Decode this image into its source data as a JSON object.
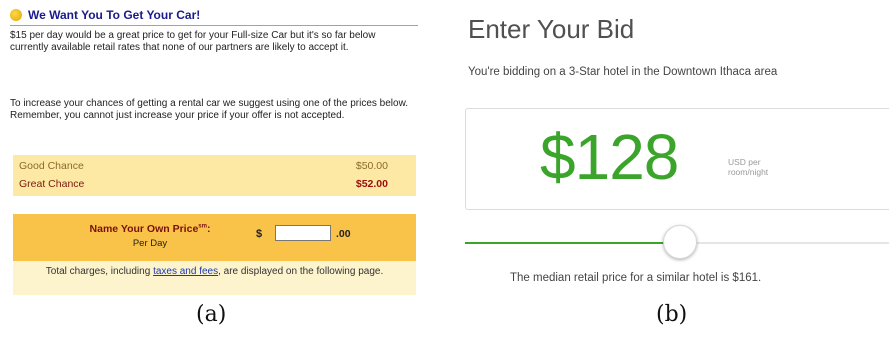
{
  "panel_a": {
    "title": "We Want You To Get Your Car!",
    "paragraph1": "$15 per day would be a great price to get for your Full-size Car but it's so far below currently available retail rates that none of our partners are likely to accept it.",
    "paragraph2": "To increase your chances of getting a rental car we suggest using one of the prices below. Remember, you cannot just increase your price if your offer is not accepted.",
    "options": [
      {
        "label": "Good Chance",
        "price": "$50.00"
      },
      {
        "label": "Great Chance",
        "price": "$52.00"
      }
    ],
    "name_price_label": "Name Your Own Price",
    "name_price_mark": "sm",
    "name_price_colon": ":",
    "per_day": "Per Day",
    "currency_symbol": "$",
    "price_value": "",
    "cents": ".00",
    "total_before": "Total charges, including ",
    "total_link": "taxes and fees",
    "total_after": ", are displayed on the following page.",
    "caption": "(a)"
  },
  "panel_b": {
    "heading": "Enter Your Bid",
    "subtitle": "You're bidding on a 3-Star hotel in the Downtown Ithaca area",
    "bid_amount": "$128",
    "unit_line1": "USD per",
    "unit_line2": "room/night",
    "slider_fraction": 0.5,
    "median_text": "The median retail price for a similar hotel is $161.",
    "accent_color": "#3aa52a",
    "caption": "(b)"
  }
}
